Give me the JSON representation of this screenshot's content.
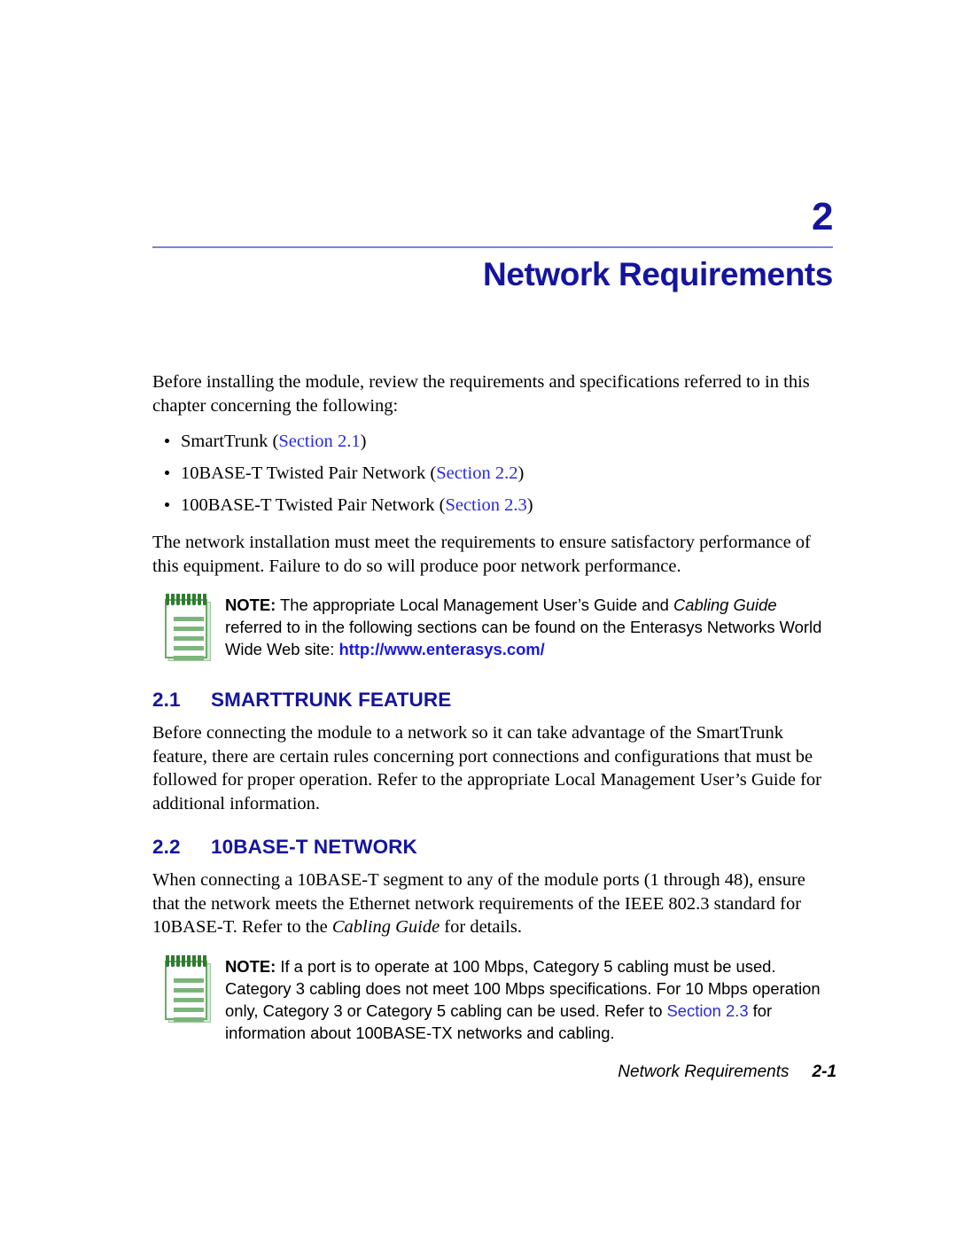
{
  "header": {
    "chapter_number": "2",
    "chapter_title": "Network Requirements",
    "rule_color": "#8080d0",
    "heading_color": "#1414a0"
  },
  "intro": {
    "paragraph": "Before installing the module, review the requirements and specifications referred to in this chapter concerning the following:"
  },
  "bullets": [
    {
      "text_before": "SmartTrunk (",
      "xref": "Section",
      "xref_num": " 2.1",
      "text_after": ")"
    },
    {
      "text_before": "10BASE-T Twisted Pair Network (",
      "xref": "Section",
      "xref_num": " 2.2",
      "text_after": ")"
    },
    {
      "text_before": "100BASE-T Twisted Pair Network (",
      "xref": "Section",
      "xref_num": " 2.3",
      "text_after": ")"
    }
  ],
  "requirements_paragraph": "The network installation must meet the requirements to ensure satisfactory performance of this equipment. Failure to do so will produce poor network performance.",
  "note_1": {
    "icon": "notepad-icon",
    "label": "NOTE:",
    "text_part_1": " The appropriate Local Management User’s Guide and ",
    "italic_title": "Cabling Guide",
    "text_part_2": " referred to in the following sections can be found on the Enterasys Networks World Wide Web site: ",
    "url": "http://www.enterasys.com/",
    "url_color": "#1a1ae0"
  },
  "sections": [
    {
      "number": "2.1",
      "title": "SMARTTRUNK FEATURE",
      "body": "Before connecting the module to a network so it can take advantage of the SmartTrunk feature, there are certain rules concerning port connections and configurations that must be followed for proper operation. Refer to the appropriate Local Management User’s Guide for additional information."
    },
    {
      "number": "2.2",
      "title": "10BASE-T NETWORK",
      "body_part_1": "When connecting a 10BASE-T segment to any of the module ports (1 through 48), ensure that the network meets the Ethernet network requirements of the IEEE 802.3 standard for 10BASE-T. Refer to the ",
      "italic_title": "Cabling Guide",
      "body_part_2": " for details."
    }
  ],
  "note_2": {
    "icon": "notepad-icon",
    "label": "NOTE:",
    "text_part_1": " If a port is to operate at 100 Mbps, Category 5 cabling must be used. Category 3 cabling does not meet 100 Mbps specifications. For 10 Mbps operation only, Category 3 or Category 5 cabling can be used. Refer to ",
    "xref": "Section 2.3",
    "text_part_2": " for information about 100BASE-TX networks and cabling.",
    "xref_color": "#2a2adc"
  },
  "footer": {
    "title": "Network Requirements",
    "page": "2-1"
  }
}
